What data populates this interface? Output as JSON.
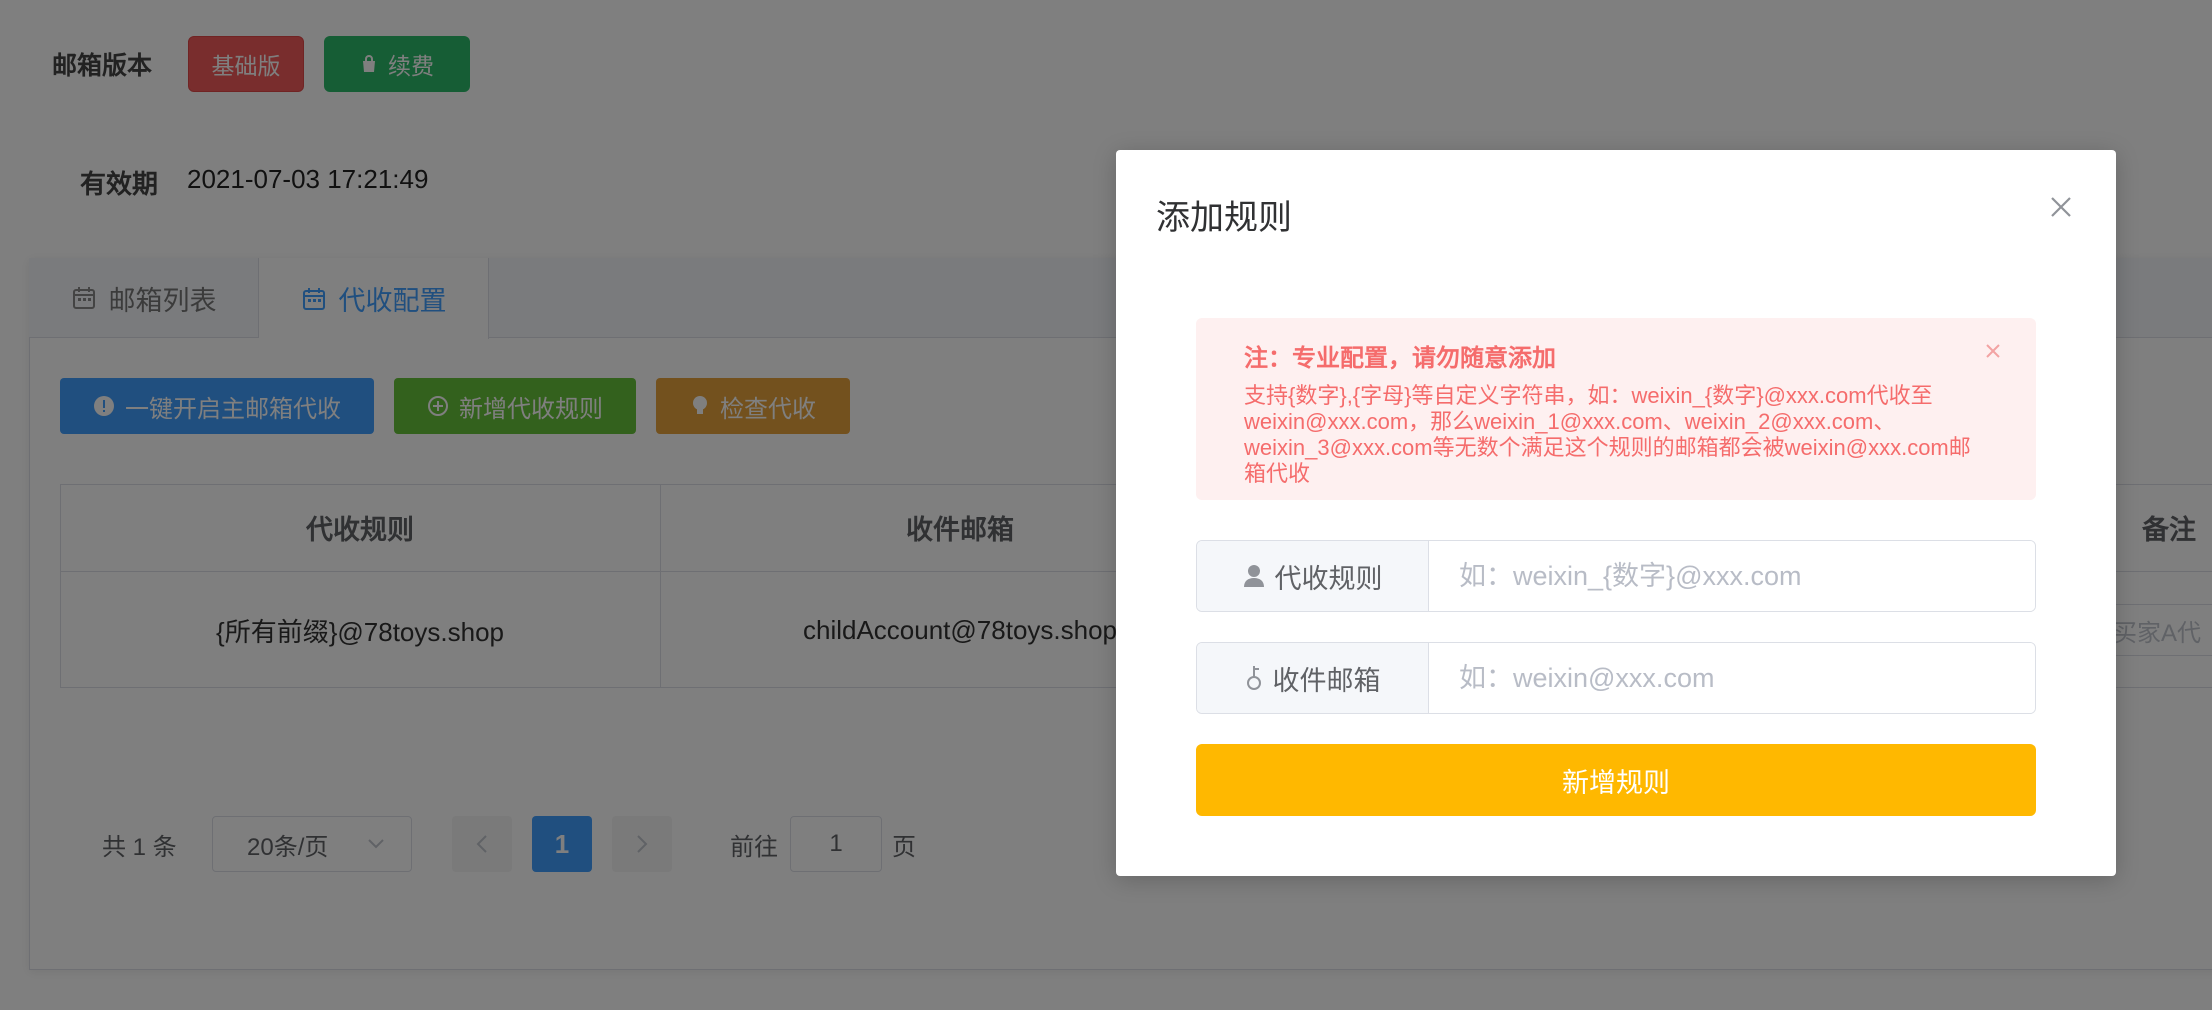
{
  "header": {
    "version_label": "邮箱版本",
    "version_badge": "基础版",
    "renew_button": "续费",
    "validity_label": "有效期",
    "validity_value": "2021-07-03 17:21:49"
  },
  "tabs": [
    {
      "label": "邮箱列表",
      "active": false
    },
    {
      "label": "代收配置",
      "active": true
    }
  ],
  "actions": {
    "open_all": "一键开启主邮箱代收",
    "add_rule": "新增代收规则",
    "check": "检查代收"
  },
  "table": {
    "columns": [
      "代收规则",
      "收件邮箱",
      "备注"
    ],
    "rows": [
      {
        "rule": "{所有前缀}@78toys.shop",
        "mailbox": "childAccount@78toys.shop",
        "remark": "买家A代"
      }
    ]
  },
  "pagination": {
    "total": "共 1 条",
    "page_size": "20条/页",
    "current_page": "1",
    "goto_label": "前往",
    "goto_value": "1",
    "page_suffix": "页"
  },
  "modal": {
    "title": "添加规则",
    "alert_title": "注：专业配置，请勿随意添加",
    "alert_desc": "支持{数字},{字母}等自定义字符串，如：weixin_{数字}@xxx.com代收至weixin@xxx.com，那么weixin_1@xxx.com、weixin_2@xxx.com、weixin_3@xxx.com等无数个满足这个规则的邮箱都会被weixin@xxx.com邮箱代收",
    "rule_label": "代收规则",
    "rule_placeholder": "如：weixin_{数字}@xxx.com",
    "mail_label": "收件邮箱",
    "mail_placeholder": "如：weixin@xxx.com",
    "submit": "新增规则"
  },
  "colors": {
    "primary": "#409eff",
    "success": "#67c23a",
    "warning": "#e6a23c",
    "danger": "#f25b5b",
    "submit": "#ffb800"
  }
}
